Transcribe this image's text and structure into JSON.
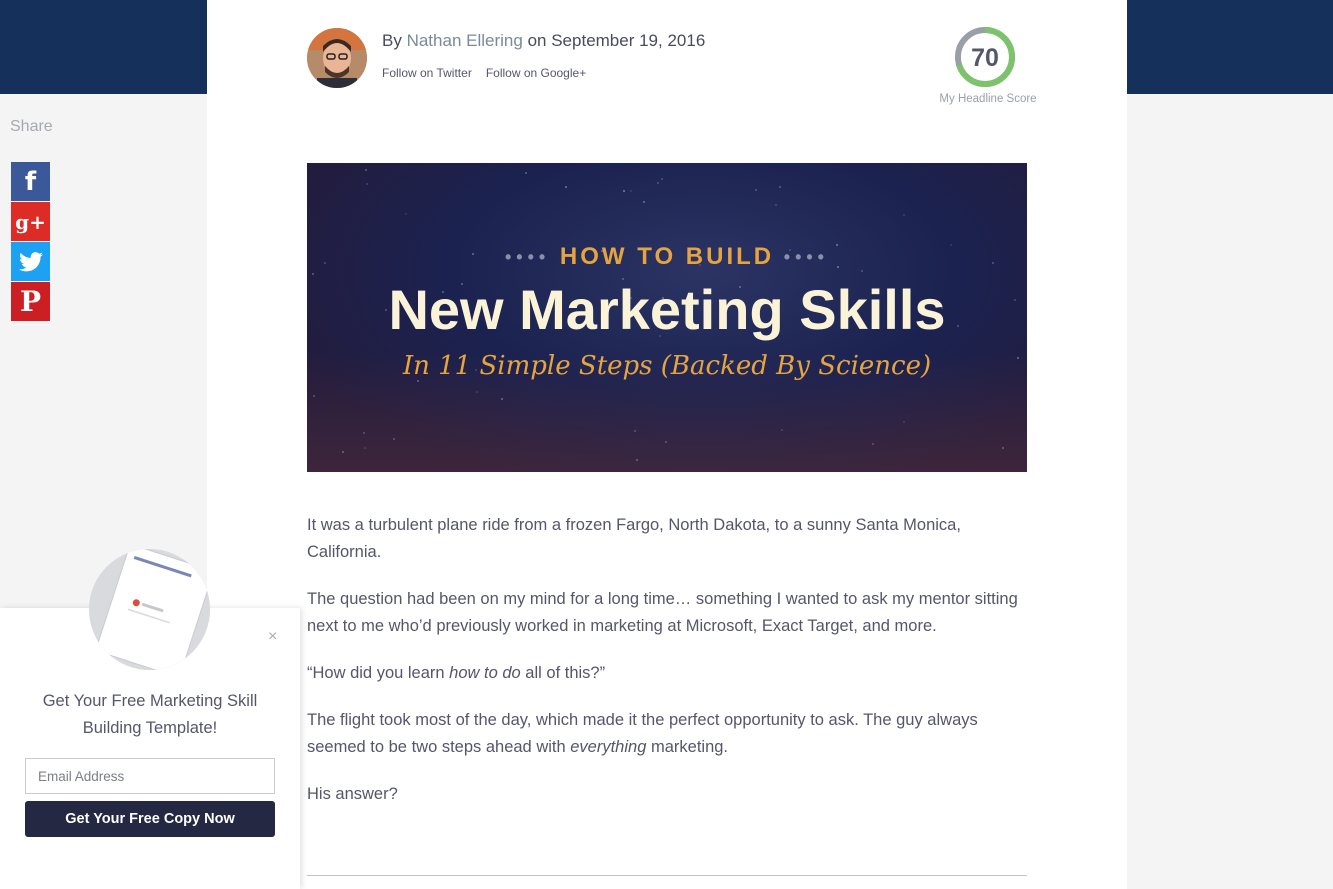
{
  "byline": {
    "prefix": "By",
    "author": "Nathan Ellering",
    "date_prefix": "on",
    "date": "September 19, 2016",
    "follow_twitter": "Follow on Twitter",
    "follow_google": "Follow on Google+"
  },
  "headline_score": {
    "value": "70",
    "score_fraction": 0.7,
    "label": "My Headline Score",
    "ring_color": "#7cc36b"
  },
  "hero": {
    "kicker": "HOW TO BUILD",
    "title": "New Marketing Skills",
    "subtitle": "In 11 Simple Steps (Backed By Science)"
  },
  "body": {
    "p1": "It was a turbulent plane ride from a frozen Fargo, North Dakota, to a sunny Santa Monica, California.",
    "p2": "The question had been on my mind for a long time… something I wanted to ask my mentor sitting next to me who’d previously worked in marketing at Microsoft, Exact Target, and more.",
    "p3_start": "“How did you learn ",
    "p3_em": "how to do",
    "p3_end": " all of this?”",
    "p4_start": "The flight took most of the day, which made it the perfect opportunity to ask. The guy always seemed to be two steps ahead with ",
    "p4_em": "everything",
    "p4_end": " marketing.",
    "p5": "His answer?"
  },
  "share": {
    "label": "Share",
    "buttons": [
      {
        "icon": "facebook-icon",
        "glyph": "f",
        "color": "#3b5998"
      },
      {
        "icon": "google-plus-icon",
        "glyph": "g+",
        "color": "#dd2b26"
      },
      {
        "icon": "twitter-icon",
        "glyph": "",
        "color": "#1da1f2"
      },
      {
        "icon": "pinterest-icon",
        "glyph": "P",
        "color": "#cb1f24"
      }
    ]
  },
  "popup": {
    "close": "×",
    "heading": "Get Your Free Marketing Skill Building Template!",
    "email_placeholder": "Email Address",
    "cta": "Get Your Free Copy Now"
  },
  "colors": {
    "top_band": "#15305a",
    "cta": "#252842",
    "accent_gold": "#e5a43f"
  }
}
